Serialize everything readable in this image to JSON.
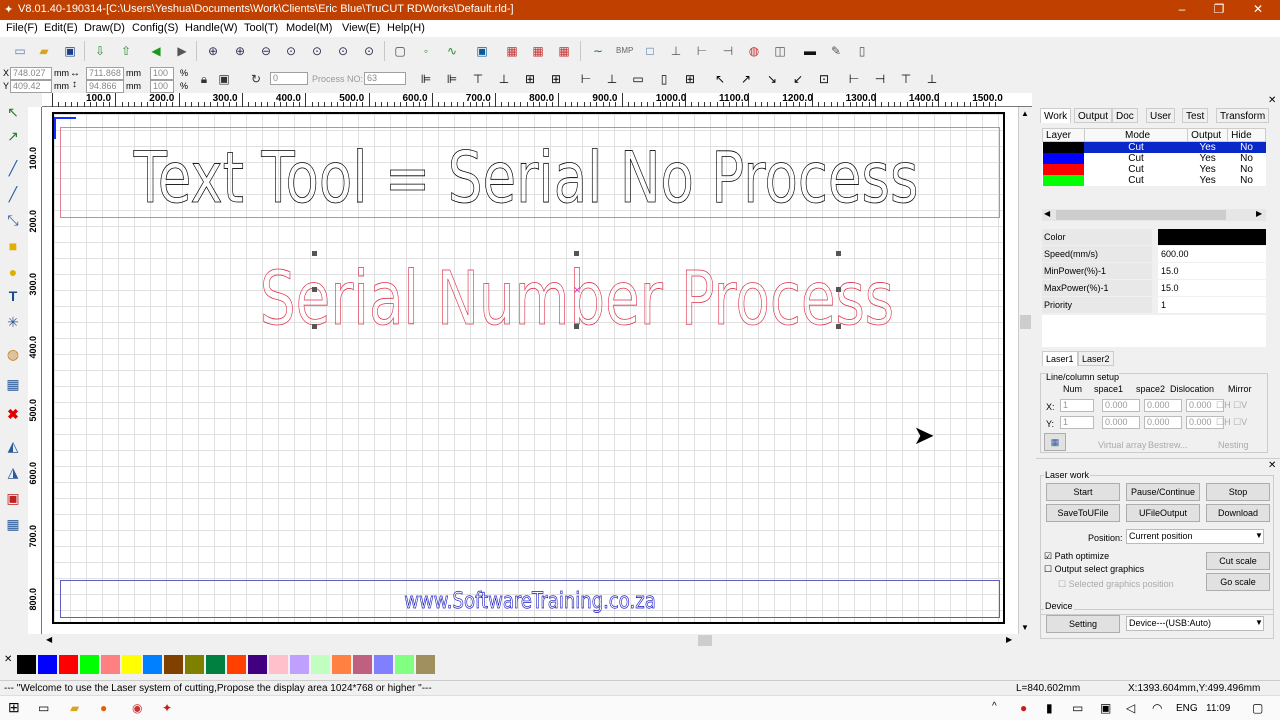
{
  "window": {
    "title": "V8.01.40-190314-[C:\\Users\\Yeshua\\Documents\\Work\\Clients\\Eric Blue\\TruCUT RDWorks\\Default.rld-]",
    "minimize": "–",
    "maximize": "❐",
    "close": "✕"
  },
  "menu": [
    "File(F)",
    "Edit(E)",
    "Draw(D)",
    "Config(S)",
    "Handle(W)",
    "Tool(T)",
    "Model(M)",
    "View(E)",
    "Help(H)"
  ],
  "coords": {
    "x_label": "X",
    "x_value": "748.027",
    "x_unit": "mm",
    "y_label": "Y",
    "y_value": "409.42",
    "y_unit": "mm",
    "w_value": "711.868",
    "w_unit": "mm",
    "h_value": "94.866",
    "h_unit": "mm",
    "sx_value": "100",
    "sx_unit": "%",
    "sy_value": "100",
    "sy_unit": "%",
    "rot_value": "0",
    "process_label": "Process NO:",
    "process_value": "63"
  },
  "hruler_ticks": [
    "100.0",
    "200.0",
    "300.0",
    "400.0",
    "500.0",
    "600.0",
    "700.0",
    "800.0",
    "900.0",
    "1000.0",
    "1100.0",
    "1200.0",
    "1300.0",
    "1400.0",
    "1500.0"
  ],
  "vruler_ticks": [
    "100.0",
    "200.0",
    "300.0",
    "400.0",
    "500.0",
    "600.0",
    "700.0",
    "800.0"
  ],
  "canvas": {
    "text1": "Text Tool = Serial No Process",
    "text2": "Serial Number Process",
    "text3": "www.SoftwareTraining.co.za",
    "color_black": "#000000",
    "color_red": "#e0304a",
    "color_blue": "#1010c0"
  },
  "palette": [
    "#000000",
    "#0000ff",
    "#ff0000",
    "#00ff00",
    "#ff8080",
    "#ffff00",
    "#0080ff",
    "#804000",
    "#808000",
    "#008040",
    "#ff4000",
    "#400080",
    "#ffc0cb",
    "#c0a0ff",
    "#c0ffc0",
    "#ff8040",
    "#c06080",
    "#8080ff",
    "#80ff80",
    "#a09060"
  ],
  "status": {
    "message": "--- \"Welcome to use the Laser system of cutting,Propose the display area 1024*768 or higher \"---",
    "length": "L=840.602mm",
    "position": "X:1393.604mm,Y:499.496mm"
  },
  "taskbar": {
    "lang": "ENG",
    "time": "11:09"
  },
  "panel": {
    "tabs": [
      "Work",
      "Output",
      "Doc",
      "User",
      "Test",
      "Transform"
    ],
    "layer_headers": [
      "Layer",
      "Mode",
      "Output",
      "Hide"
    ],
    "layers": [
      {
        "color": "#000000",
        "mode": "Cut",
        "output": "Yes",
        "hide": "No"
      },
      {
        "color": "#0000ff",
        "mode": "Cut",
        "output": "Yes",
        "hide": "No"
      },
      {
        "color": "#ff0000",
        "mode": "Cut",
        "output": "Yes",
        "hide": "No"
      },
      {
        "color": "#00ff00",
        "mode": "Cut",
        "output": "Yes",
        "hide": "No"
      }
    ],
    "props": [
      {
        "k": "Color",
        "v": ""
      },
      {
        "k": "Speed(mm/s)",
        "v": "600.00"
      },
      {
        "k": "MinPower(%)-1",
        "v": "15.0"
      },
      {
        "k": "MaxPower(%)-1",
        "v": "15.0"
      },
      {
        "k": "Priority",
        "v": "1"
      }
    ],
    "laser_tabs": [
      "Laser1",
      "Laser2"
    ],
    "array": {
      "title": "Line/column setup",
      "h_num": "Num",
      "h_space1": "space1",
      "h_space2": "space2",
      "h_disloc": "Dislocation",
      "h_mirror": "Mirror",
      "x": "X:",
      "y": "Y:",
      "num": "1",
      "v": "0.000",
      "virtual": "Virtual array",
      "bestrew": "Bestrew...",
      "nesting": "Nesting",
      "h": "H",
      "vv": "V"
    },
    "laser_work": {
      "title": "Laser work",
      "start": "Start",
      "pause": "Pause/Continue",
      "stop": "Stop",
      "save": "SaveToUFile",
      "ufile": "UFileOutput",
      "download": "Download",
      "position_label": "Position:",
      "position_value": "Current position",
      "path_opt": "Path optimize",
      "out_sel": "Output select graphics",
      "sel_pos": "Selected graphics position",
      "cut_scale": "Cut scale",
      "go_scale": "Go scale"
    },
    "device": {
      "title": "Device",
      "setting": "Setting",
      "value": "Device---(USB:Auto)"
    }
  }
}
